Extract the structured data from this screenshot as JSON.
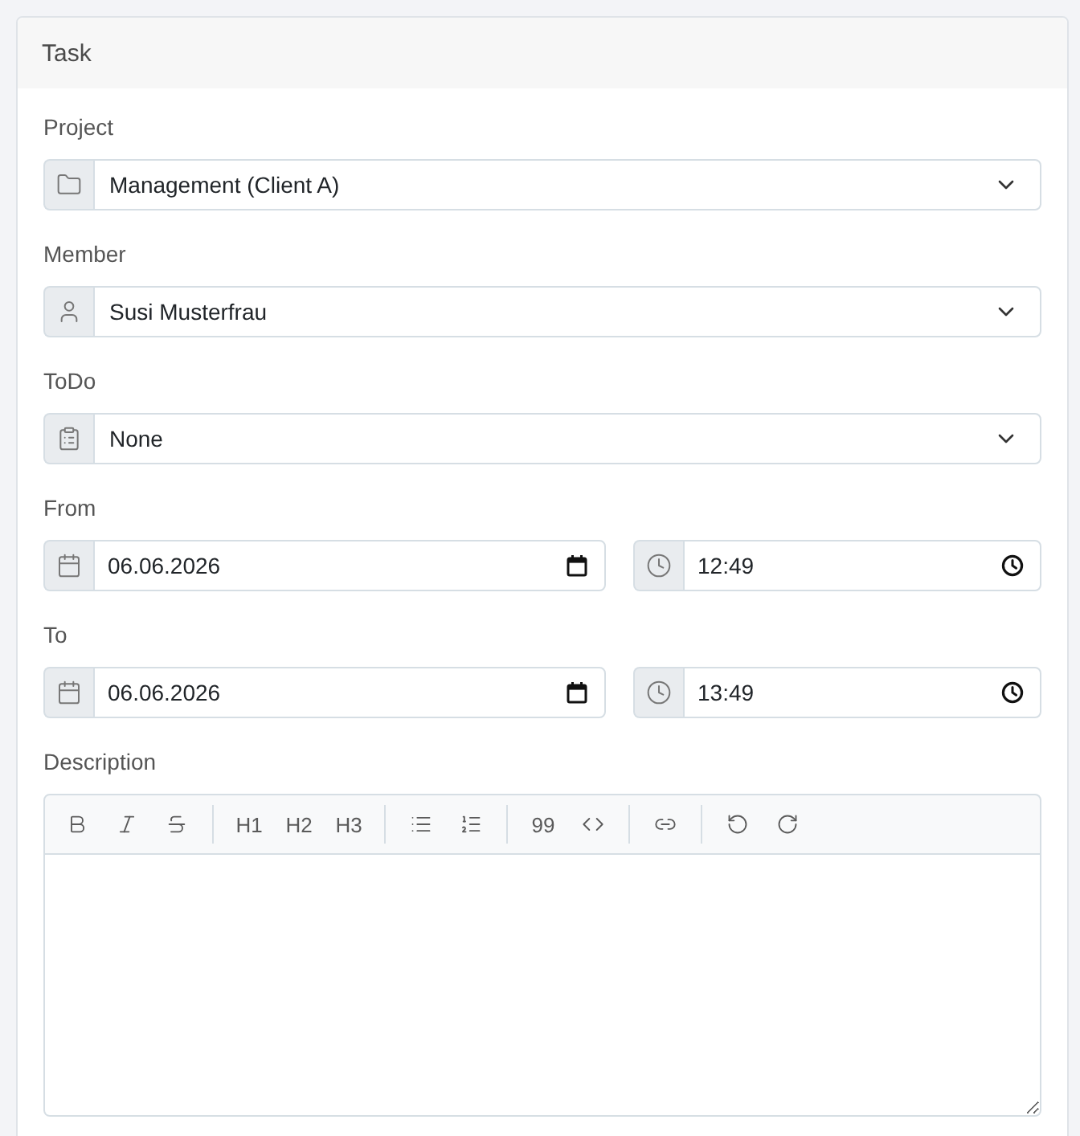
{
  "card": {
    "title": "Task"
  },
  "project": {
    "label": "Project",
    "value": "Management (Client A)"
  },
  "member": {
    "label": "Member",
    "value": "Susi Musterfrau"
  },
  "todo": {
    "label": "ToDo",
    "value": "None"
  },
  "from": {
    "label": "From",
    "date": "06.06.2026",
    "time": "12:49"
  },
  "to": {
    "label": "To",
    "date": "06.06.2026",
    "time": "13:49"
  },
  "description": {
    "label": "Description",
    "toolbar": {
      "headings": [
        "H1",
        "H2",
        "H3"
      ],
      "quote": "99"
    }
  }
}
